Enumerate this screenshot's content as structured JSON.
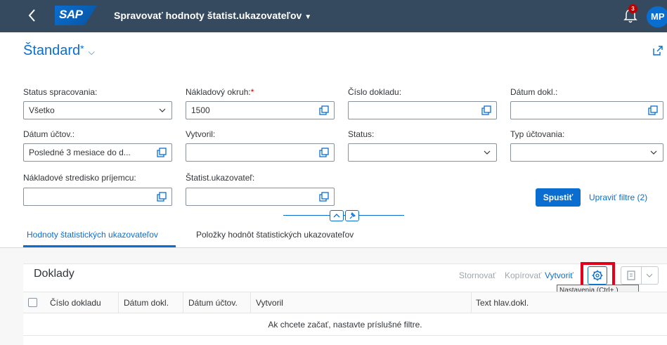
{
  "shell": {
    "back_icon": "arrow-left-icon",
    "logo": "SAP",
    "title": "Spravovať hodnoty štatist.ukazovateľov",
    "notification_count": "3",
    "avatar_initials": "MP"
  },
  "variant": {
    "name": "Štandard",
    "modified_marker": "*"
  },
  "filters": {
    "status_label": "Status spracovania:",
    "status_value": "Všetko",
    "cost_area_label": "Nákladový okruh:",
    "cost_area_required": "*",
    "cost_area_value": "1500",
    "doc_number_label": "Číslo dokladu:",
    "doc_date_label": "Dátum dokl.:",
    "posting_date_label": "Dátum účtov.:",
    "posting_date_value": "Posledné 3 mesiace do d...",
    "created_by_label": "Vytvoril:",
    "status2_label": "Status:",
    "posting_type_label": "Typ účtovania:",
    "receiver_cc_label": "Nákladové stredisko príjemcu:",
    "stat_key_label": "Štatist.ukazovateľ:",
    "go_label": "Spustiť",
    "adapt_label": "Upraviť filtre (2)"
  },
  "tabs": [
    {
      "label": "Hodnoty štatistických ukazovateľov",
      "selected": true
    },
    {
      "label": "Položky hodnôt štatistických ukazovateľov",
      "selected": false
    }
  ],
  "table": {
    "title": "Doklady",
    "toolbar": {
      "reverse": "Stornovať",
      "copy": "Kopírovať",
      "create": "Vytvoriť"
    },
    "tooltip": "Nastavenia (Ctrl+,)",
    "columns": [
      "Číslo dokladu",
      "Dátum dokl.",
      "Dátum účtov.",
      "Vytvoril",
      "Text hlav.dokl."
    ],
    "empty_text": "Ak chcete začať, nastavte príslušné filtre."
  },
  "colors": {
    "shell": "#354a5f",
    "brand": "#0a6ed1",
    "highlight": "#e3001b"
  }
}
